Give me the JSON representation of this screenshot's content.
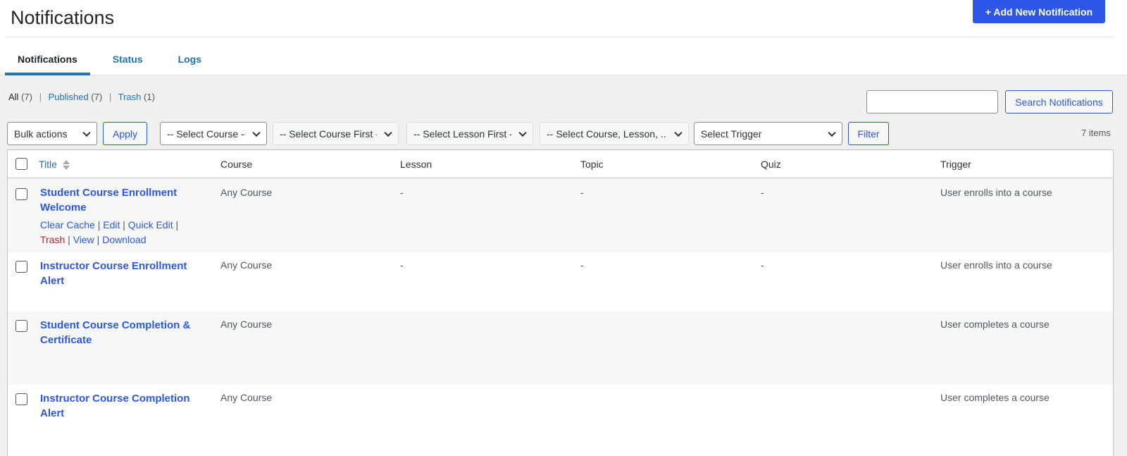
{
  "header": {
    "title": "Notifications",
    "add_new_label": "+ Add New Notification"
  },
  "tabs": [
    {
      "label": "Notifications",
      "active": true
    },
    {
      "label": "Status",
      "active": false
    },
    {
      "label": "Logs",
      "active": false
    }
  ],
  "views": {
    "all_label": "All",
    "all_count": "(7)",
    "published_label": "Published",
    "published_count": "(7)",
    "trash_label": "Trash",
    "trash_count": "(1)"
  },
  "search": {
    "value": "",
    "button_label": "Search Notifications"
  },
  "filters": {
    "bulk_actions": "Bulk actions",
    "apply_label": "Apply",
    "course": "-- Select Course --",
    "course_first": "-- Select Course First --",
    "lesson_first": "-- Select Lesson First --",
    "course_lesson": "-- Select Course, Lesson, ...",
    "trigger": "Select Trigger",
    "filter_label": "Filter"
  },
  "items_count": "7 items",
  "table": {
    "columns": [
      "Title",
      "Course",
      "Lesson",
      "Topic",
      "Quiz",
      "Trigger"
    ],
    "rows": [
      {
        "title": "Student Course Enrollment Welcome",
        "course": "Any Course",
        "lesson": "-",
        "topic": "-",
        "quiz": "-",
        "trigger": "User enrolls into a course",
        "actions": [
          "Clear Cache",
          "Edit",
          "Quick Edit",
          "Trash",
          "View",
          "Download"
        ]
      },
      {
        "title": "Instructor Course Enrollment Alert",
        "course": "Any Course",
        "lesson": "-",
        "topic": "-",
        "quiz": "-",
        "trigger": "User enrolls into a course"
      },
      {
        "title": "Student Course Completion & Certificate",
        "course": "Any Course",
        "lesson": "",
        "topic": "",
        "quiz": "",
        "trigger": "User completes a course"
      },
      {
        "title": "Instructor Course Completion Alert",
        "course": "Any Course",
        "lesson": "",
        "topic": "",
        "quiz": "",
        "trigger": "User completes a course"
      }
    ]
  },
  "colors": {
    "accent": "#2c56e6",
    "link": "#2271b1",
    "trash": "#b32d2e",
    "background": "#f0f0f1"
  }
}
